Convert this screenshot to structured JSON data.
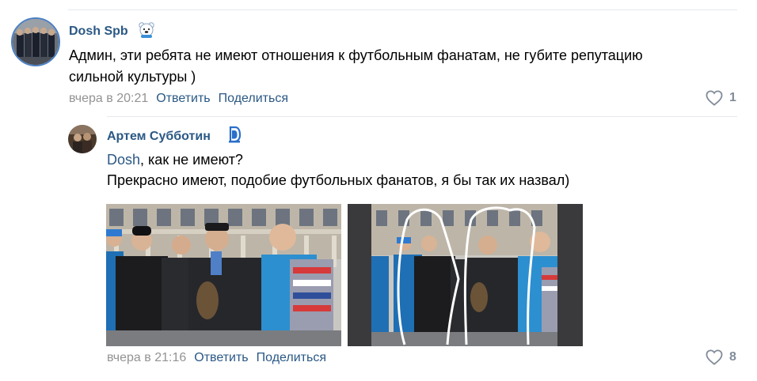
{
  "comment1": {
    "author": "Dosh Spb",
    "badge_icon": "bear-sticker-icon",
    "text_line1": "Админ, эти ребята не имеют отношения к футбольным фанатам, не губите репутацию",
    "text_line2": "сильной культуры )",
    "time": "вчера в 20:21",
    "reply_label": "Ответить",
    "share_label": "Поделиться",
    "likes": "1"
  },
  "comment2": {
    "author": "Артем Субботин",
    "badge_icon": "dynamo-logo-icon",
    "mention": "Dosh",
    "text_line1_rest": ", как не имеют?",
    "text_line2": "Прекрасно имеют, подобие футбольных фанатов, я бы так их назвал)",
    "time": "вчера в 21:16",
    "reply_label": "Ответить",
    "share_label": "Поделиться",
    "likes": "8"
  },
  "colors": {
    "link": "#2a5885",
    "meta": "#939393",
    "divider": "#e7e8ec",
    "like_icon": "#818c99"
  }
}
